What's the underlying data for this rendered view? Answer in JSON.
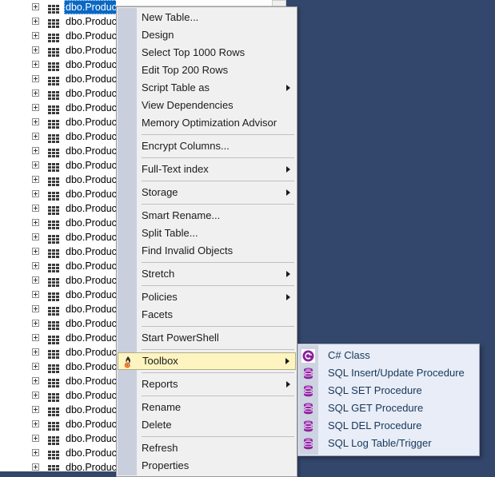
{
  "desktop": {
    "background_color": "#33466b"
  },
  "object_explorer": {
    "selected_row_color": "#0a68c4",
    "rows": [
      {
        "label": "dbo.Product",
        "icon": "table-icon",
        "expander": "plus-icon",
        "selected": true
      },
      {
        "label": "dbo.Product",
        "icon": "table-icon",
        "expander": "plus-icon",
        "selected": false
      },
      {
        "label": "dbo.Product",
        "icon": "table-icon",
        "expander": "plus-icon",
        "selected": false
      },
      {
        "label": "dbo.Product",
        "icon": "table-icon",
        "expander": "plus-icon",
        "selected": false
      },
      {
        "label": "dbo.Product",
        "icon": "table-icon",
        "expander": "plus-icon",
        "selected": false
      },
      {
        "label": "dbo.Product",
        "icon": "table-icon",
        "expander": "plus-icon",
        "selected": false
      },
      {
        "label": "dbo.Product",
        "icon": "table-icon",
        "expander": "plus-icon",
        "selected": false
      },
      {
        "label": "dbo.Product",
        "icon": "table-icon",
        "expander": "plus-icon",
        "selected": false
      },
      {
        "label": "dbo.Product",
        "icon": "table-icon",
        "expander": "plus-icon",
        "selected": false
      },
      {
        "label": "dbo.Product",
        "icon": "table-icon",
        "expander": "plus-icon",
        "selected": false
      },
      {
        "label": "dbo.Product",
        "icon": "table-icon",
        "expander": "plus-icon",
        "selected": false
      },
      {
        "label": "dbo.Product",
        "icon": "table-icon",
        "expander": "plus-icon",
        "selected": false
      },
      {
        "label": "dbo.Product",
        "icon": "table-icon",
        "expander": "plus-icon",
        "selected": false
      },
      {
        "label": "dbo.Product",
        "icon": "table-icon",
        "expander": "plus-icon",
        "selected": false
      },
      {
        "label": "dbo.Product",
        "icon": "table-icon",
        "expander": "plus-icon",
        "selected": false
      },
      {
        "label": "dbo.Product",
        "icon": "table-icon",
        "expander": "plus-icon",
        "selected": false
      },
      {
        "label": "dbo.Product",
        "icon": "table-icon",
        "expander": "plus-icon",
        "selected": false
      },
      {
        "label": "dbo.Product",
        "icon": "table-icon",
        "expander": "plus-icon",
        "selected": false
      },
      {
        "label": "dbo.Product",
        "icon": "table-icon",
        "expander": "plus-icon",
        "selected": false
      },
      {
        "label": "dbo.Product",
        "icon": "table-icon",
        "expander": "plus-icon",
        "selected": false
      },
      {
        "label": "dbo.Product",
        "icon": "table-icon",
        "expander": "plus-icon",
        "selected": false
      },
      {
        "label": "dbo.Product",
        "icon": "table-icon",
        "expander": "plus-icon",
        "selected": false
      },
      {
        "label": "dbo.Product",
        "icon": "table-icon",
        "expander": "plus-icon",
        "selected": false
      },
      {
        "label": "dbo.Product",
        "icon": "table-icon",
        "expander": "plus-icon",
        "selected": false
      },
      {
        "label": "dbo.Product",
        "icon": "table-icon",
        "expander": "plus-icon",
        "selected": false
      },
      {
        "label": "dbo.Product",
        "icon": "table-icon",
        "expander": "plus-icon",
        "selected": false
      },
      {
        "label": "dbo.Product",
        "icon": "table-icon",
        "expander": "plus-icon",
        "selected": false
      },
      {
        "label": "dbo.Product",
        "icon": "table-icon",
        "expander": "plus-icon",
        "selected": false
      },
      {
        "label": "dbo.Product",
        "icon": "table-icon",
        "expander": "plus-icon",
        "selected": false
      },
      {
        "label": "dbo.Product",
        "icon": "table-icon",
        "expander": "plus-icon",
        "selected": false
      },
      {
        "label": "dbo.Product",
        "icon": "table-icon",
        "expander": "plus-icon",
        "selected": false
      },
      {
        "label": "dbo.Product",
        "icon": "table-icon",
        "expander": "plus-icon",
        "selected": false
      },
      {
        "label": "dbo.ProductPriceCampaignDetail",
        "icon": "table-icon",
        "expander": "plus-icon",
        "selected": false
      }
    ]
  },
  "context_menu": {
    "highlight_color": "#fdf4bf",
    "items": [
      {
        "type": "item",
        "label": "New Table...",
        "submenu": false,
        "icon": null
      },
      {
        "type": "item",
        "label": "Design",
        "submenu": false,
        "icon": null
      },
      {
        "type": "item",
        "label": "Select Top 1000 Rows",
        "submenu": false,
        "icon": null
      },
      {
        "type": "item",
        "label": "Edit Top 200 Rows",
        "submenu": false,
        "icon": null
      },
      {
        "type": "item",
        "label": "Script Table as",
        "submenu": true,
        "icon": null
      },
      {
        "type": "item",
        "label": "View Dependencies",
        "submenu": false,
        "icon": null
      },
      {
        "type": "item",
        "label": "Memory Optimization Advisor",
        "submenu": false,
        "icon": null
      },
      {
        "type": "separator"
      },
      {
        "type": "item",
        "label": "Encrypt Columns...",
        "submenu": false,
        "icon": null
      },
      {
        "type": "separator"
      },
      {
        "type": "item",
        "label": "Full-Text index",
        "submenu": true,
        "icon": null
      },
      {
        "type": "separator"
      },
      {
        "type": "item",
        "label": "Storage",
        "submenu": true,
        "icon": null
      },
      {
        "type": "separator"
      },
      {
        "type": "item",
        "label": "Smart Rename...",
        "submenu": false,
        "icon": null
      },
      {
        "type": "item",
        "label": "Split Table...",
        "submenu": false,
        "icon": null
      },
      {
        "type": "item",
        "label": "Find Invalid Objects",
        "submenu": false,
        "icon": null
      },
      {
        "type": "separator"
      },
      {
        "type": "item",
        "label": "Stretch",
        "submenu": true,
        "icon": null
      },
      {
        "type": "separator"
      },
      {
        "type": "item",
        "label": "Policies",
        "submenu": true,
        "icon": null
      },
      {
        "type": "item",
        "label": "Facets",
        "submenu": false,
        "icon": null
      },
      {
        "type": "separator"
      },
      {
        "type": "item",
        "label": "Start PowerShell",
        "submenu": false,
        "icon": null
      },
      {
        "type": "separator"
      },
      {
        "type": "item",
        "label": "Toolbox",
        "submenu": true,
        "icon": "flame-icon",
        "highlighted": true
      },
      {
        "type": "separator"
      },
      {
        "type": "item",
        "label": "Reports",
        "submenu": true,
        "icon": null
      },
      {
        "type": "separator"
      },
      {
        "type": "item",
        "label": "Rename",
        "submenu": false,
        "icon": null
      },
      {
        "type": "item",
        "label": "Delete",
        "submenu": false,
        "icon": null
      },
      {
        "type": "separator"
      },
      {
        "type": "item",
        "label": "Refresh",
        "submenu": false,
        "icon": null
      },
      {
        "type": "item",
        "label": "Properties",
        "submenu": false,
        "icon": null
      }
    ]
  },
  "submenu": {
    "parent": "Toolbox",
    "background_color": "#e8edf7",
    "icon_color": "#8c1f9e",
    "items": [
      {
        "label": "C# Class",
        "icon": "csharp-class-icon"
      },
      {
        "label": "SQL Insert/Update Procedure",
        "icon": "database-icon"
      },
      {
        "label": "SQL SET Procedure",
        "icon": "database-icon"
      },
      {
        "label": "SQL GET Procedure",
        "icon": "database-icon"
      },
      {
        "label": "SQL DEL Procedure",
        "icon": "database-icon"
      },
      {
        "label": "SQL Log Table/Trigger",
        "icon": "database-icon"
      }
    ]
  }
}
